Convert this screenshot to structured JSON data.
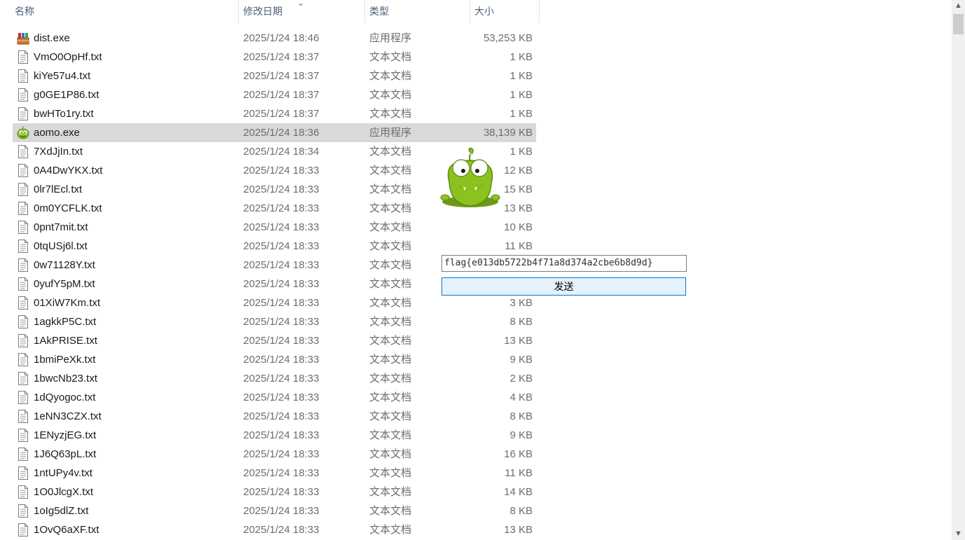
{
  "columns": {
    "name": "名称",
    "date": "修改日期",
    "type": "类型",
    "size": "大小"
  },
  "files": [
    {
      "name": "dist.exe",
      "date": "2025/1/24 18:46",
      "type": "应用程序",
      "size": "53,253 KB",
      "icon": "installer-package-icon",
      "selected": false
    },
    {
      "name": "VmO0OpHf.txt",
      "date": "2025/1/24 18:37",
      "type": "文本文档",
      "size": "1 KB",
      "icon": "text-file-icon",
      "selected": false
    },
    {
      "name": "kiYe57u4.txt",
      "date": "2025/1/24 18:37",
      "type": "文本文档",
      "size": "1 KB",
      "icon": "text-file-icon",
      "selected": false
    },
    {
      "name": "g0GE1P86.txt",
      "date": "2025/1/24 18:37",
      "type": "文本文档",
      "size": "1 KB",
      "icon": "text-file-icon",
      "selected": false
    },
    {
      "name": "bwHTo1ry.txt",
      "date": "2025/1/24 18:37",
      "type": "文本文档",
      "size": "1 KB",
      "icon": "text-file-icon",
      "selected": false
    },
    {
      "name": "aomo.exe",
      "date": "2025/1/24 18:36",
      "type": "应用程序",
      "size": "38,139 KB",
      "icon": "om-nom-app-icon",
      "selected": true
    },
    {
      "name": "7XdJjIn.txt",
      "date": "2025/1/24 18:34",
      "type": "文本文档",
      "size": "1 KB",
      "icon": "text-file-icon",
      "selected": false
    },
    {
      "name": "0A4DwYKX.txt",
      "date": "2025/1/24 18:33",
      "type": "文本文档",
      "size": "12 KB",
      "icon": "text-file-icon",
      "selected": false
    },
    {
      "name": "0lr7lEcl.txt",
      "date": "2025/1/24 18:33",
      "type": "文本文档",
      "size": "15 KB",
      "icon": "text-file-icon",
      "selected": false
    },
    {
      "name": "0m0YCFLK.txt",
      "date": "2025/1/24 18:33",
      "type": "文本文档",
      "size": "13 KB",
      "icon": "text-file-icon",
      "selected": false
    },
    {
      "name": "0pnt7mit.txt",
      "date": "2025/1/24 18:33",
      "type": "文本文档",
      "size": "10 KB",
      "icon": "text-file-icon",
      "selected": false
    },
    {
      "name": "0tqUSj6l.txt",
      "date": "2025/1/24 18:33",
      "type": "文本文档",
      "size": "11 KB",
      "icon": "text-file-icon",
      "selected": false
    },
    {
      "name": "0w71128Y.txt",
      "date": "2025/1/24 18:33",
      "type": "文本文档",
      "size": "",
      "icon": "text-file-icon",
      "selected": false
    },
    {
      "name": "0yufY5pM.txt",
      "date": "2025/1/24 18:33",
      "type": "文本文档",
      "size": "",
      "icon": "text-file-icon",
      "selected": false
    },
    {
      "name": "01XiW7Km.txt",
      "date": "2025/1/24 18:33",
      "type": "文本文档",
      "size": "3 KB",
      "icon": "text-file-icon",
      "selected": false
    },
    {
      "name": "1agkkP5C.txt",
      "date": "2025/1/24 18:33",
      "type": "文本文档",
      "size": "8 KB",
      "icon": "text-file-icon",
      "selected": false
    },
    {
      "name": "1AkPRISE.txt",
      "date": "2025/1/24 18:33",
      "type": "文本文档",
      "size": "13 KB",
      "icon": "text-file-icon",
      "selected": false
    },
    {
      "name": "1bmiPeXk.txt",
      "date": "2025/1/24 18:33",
      "type": "文本文档",
      "size": "9 KB",
      "icon": "text-file-icon",
      "selected": false
    },
    {
      "name": "1bwcNb23.txt",
      "date": "2025/1/24 18:33",
      "type": "文本文档",
      "size": "2 KB",
      "icon": "text-file-icon",
      "selected": false
    },
    {
      "name": "1dQyogoc.txt",
      "date": "2025/1/24 18:33",
      "type": "文本文档",
      "size": "4 KB",
      "icon": "text-file-icon",
      "selected": false
    },
    {
      "name": "1eNN3CZX.txt",
      "date": "2025/1/24 18:33",
      "type": "文本文档",
      "size": "8 KB",
      "icon": "text-file-icon",
      "selected": false
    },
    {
      "name": "1ENyzjEG.txt",
      "date": "2025/1/24 18:33",
      "type": "文本文档",
      "size": "9 KB",
      "icon": "text-file-icon",
      "selected": false
    },
    {
      "name": "1J6Q63pL.txt",
      "date": "2025/1/24 18:33",
      "type": "文本文档",
      "size": "16 KB",
      "icon": "text-file-icon",
      "selected": false
    },
    {
      "name": "1ntUPy4v.txt",
      "date": "2025/1/24 18:33",
      "type": "文本文档",
      "size": "11 KB",
      "icon": "text-file-icon",
      "selected": false
    },
    {
      "name": "1O0JlcgX.txt",
      "date": "2025/1/24 18:33",
      "type": "文本文档",
      "size": "14 KB",
      "icon": "text-file-icon",
      "selected": false
    },
    {
      "name": "1oIg5dlZ.txt",
      "date": "2025/1/24 18:33",
      "type": "文本文档",
      "size": "8 KB",
      "icon": "text-file-icon",
      "selected": false
    },
    {
      "name": "1OvQ6aXF.txt",
      "date": "2025/1/24 18:33",
      "type": "文本文档",
      "size": "13 KB",
      "icon": "text-file-icon",
      "selected": false
    }
  ],
  "popup": {
    "flag_value": "flag{e013db5722b4f71a8d374a2cbe6b8d9d}",
    "send_label": "发送",
    "mascot_icon": "om-nom-mascot-icon"
  },
  "colors": {
    "selected_row": "#d9d9d9",
    "button_border": "#0078d7",
    "button_fill": "#e5f1fb",
    "mascot_green": "#8cc21f"
  }
}
